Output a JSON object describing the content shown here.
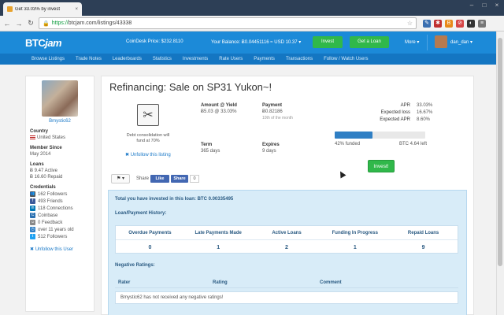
{
  "browser": {
    "tab_title": "Get 33.03% by invest",
    "tab_close": "×",
    "url_scheme": "https://",
    "url_rest": "btcjam.com/listings/43338",
    "window_controls": [
      "–",
      "□",
      "×"
    ]
  },
  "header": {
    "logo_prefix": "BTC",
    "logo_suffix": "jam",
    "coindesk_price": "CoinDesk Price: $232.8110",
    "balance": "Your Balance: Ƀ0.04451116 ≈ USD 10.37  ▾",
    "invest_label": "Invest",
    "get_loan_label": "Get a Loan",
    "more_label": "More  ▾",
    "username": "dan_dan  ▾"
  },
  "subnav": {
    "items": [
      "Browse Listings",
      "Trade Notes",
      "Leaderboards",
      "Statistics",
      "Investments",
      "Rate Users",
      "Payments",
      "Transactions",
      "Follow / Watch Users"
    ]
  },
  "profile": {
    "name": "Bmystic62",
    "country_label": "Country",
    "country_value": "United States",
    "member_since_label": "Member Since",
    "member_since_value": "May 2014",
    "loans_label": "Loans",
    "loans_active": "Ƀ 9.47 Active",
    "loans_repaid": "Ƀ 16.60 Repaid",
    "credentials_label": "Credentials",
    "credentials": [
      {
        "icon": "users-icon",
        "text": "162 Followers",
        "color": "#555555"
      },
      {
        "icon": "facebook-icon",
        "text": "493 Friends",
        "color": "#3b5998"
      },
      {
        "icon": "linkedin-icon",
        "text": "118 Connections",
        "color": "#0077b5"
      },
      {
        "icon": "coinbase-icon",
        "text": "Coinbase",
        "color": "#2b71b1"
      },
      {
        "icon": "feedback-icon",
        "text": "0 Feedback",
        "color": "#888888"
      },
      {
        "icon": "clock-icon",
        "text": "over 11 years old",
        "color": "#2f7fc4"
      },
      {
        "icon": "twitter-icon",
        "text": "512 Followers",
        "color": "#1da1f2"
      }
    ],
    "unfollow_user": "Unfollow this User"
  },
  "listing": {
    "title": "Refinancing: Sale on SP31 Yukon~!",
    "category_caption": "Debt consolidation will fund at 70%",
    "unfollow_listing": "Unfollow this listing",
    "amount_label": "Amount @ Yield",
    "amount_value": "Ƀ5.03 @ 33.03%",
    "payment_label": "Payment",
    "payment_value": "Ƀ0.82186",
    "payment_sub": "10th of the month",
    "term_label": "Term",
    "term_value": "365 days",
    "expires_label": "Expires",
    "expires_value": "9 days",
    "apr_label": "APR",
    "apr_value": "33.03%",
    "expected_loss_label": "Expected loss",
    "expected_loss_value": "16.67%",
    "expected_apr_label": "Expected APR",
    "expected_apr_value": "8.60%",
    "funded_fraction": 0.42,
    "funded_text": "42% funded",
    "btc_left": "BTC 4.64 left",
    "invest_button": "Invest!",
    "flag_button": "⚑ ▾",
    "share_label": "Share",
    "fb_like": "Like",
    "fb_share": "Share",
    "fb_count": "0"
  },
  "investment": {
    "total_text": "Total you have invested in this loan: BTC 0.00335495",
    "history_label": "Loan/Payment History:",
    "headers": [
      "Overdue Payments",
      "Late Payments Made",
      "Active Loans",
      "Funding In Progress",
      "Repaid Loans"
    ],
    "values": [
      "0",
      "1",
      "2",
      "1",
      "9"
    ],
    "negative_label": "Negative Ratings:",
    "neg_headers": [
      "Rater",
      "Rating",
      "Comment"
    ],
    "neg_empty": "Bmystic62 has not received any negative ratings!"
  },
  "colors": {
    "header_blue": "#1c8ad8",
    "subnav_blue": "#1476c2",
    "green": "#30b84a",
    "info_bg": "#d8ecf8"
  }
}
